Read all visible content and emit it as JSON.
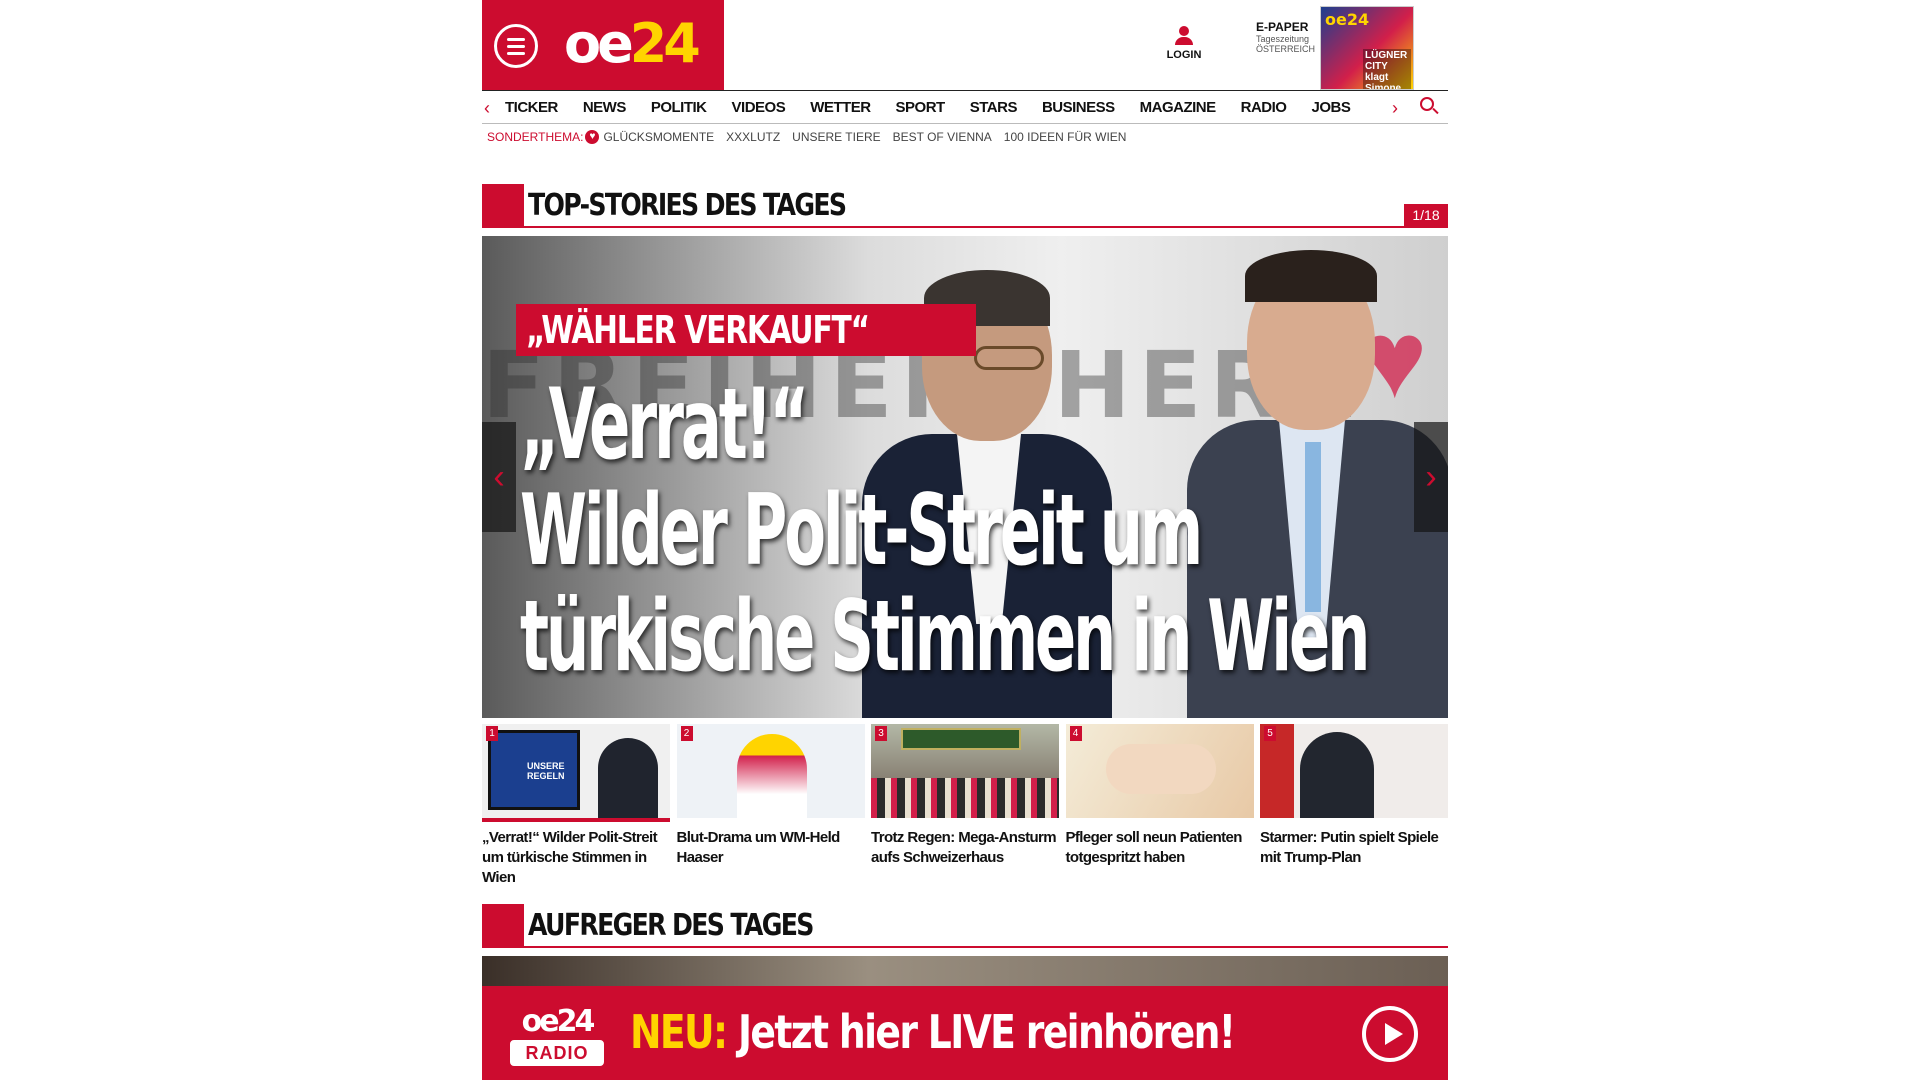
{
  "header": {
    "logo_text": "oe24",
    "login_label": "LOGIN",
    "epaper": {
      "title": "E-PAPER",
      "line2": "Tageszeitung",
      "line3": "ÖSTERREICH"
    },
    "cover_headline": "LÜGNER CITY klagt Simone",
    "brand_color": "#cc0c2f",
    "accent_color": "#ffd400"
  },
  "nav": {
    "items": [
      "TICKER",
      "NEWS",
      "POLITIK",
      "VIDEOS",
      "WETTER",
      "SPORT",
      "STARS",
      "BUSINESS",
      "MAGAZINE",
      "RADIO",
      "JOBS"
    ],
    "prev_arrow": "‹",
    "next_arrow": "›",
    "search_icon": "search-icon"
  },
  "subnav": {
    "label": "SONDERTHEMA:",
    "links": [
      "GLÜCKSMOMENTE",
      "XXXLUTZ",
      "UNSERE TIERE",
      "BEST OF VIENNA",
      "100 IDEEN FÜR WIEN"
    ]
  },
  "top_stories": {
    "title": "TOP-STORIES DES TAGES",
    "counter": "1/18",
    "hero": {
      "kicker": "„WÄHLER VERKAUFT“",
      "headline_line1": "„Verrat!“",
      "headline_line2": "Wilder Polit-Streit um",
      "headline_line3": "türkische Stimmen in Wien",
      "background_text": "FREIHEIT HERZ"
    },
    "thumbnails": [
      {
        "num": "1",
        "caption": "„Verrat!“ Wilder Polit-Streit um türkische Stimmen in Wien",
        "screen_text": "UNSERE REGELN"
      },
      {
        "num": "2",
        "caption": "Blut-Drama um WM-Held Haaser"
      },
      {
        "num": "3",
        "caption": "Trotz Regen: Mega-Ansturm aufs Schweizerhaus"
      },
      {
        "num": "4",
        "caption": "Pfleger soll neun Patienten totgespritzt haben"
      },
      {
        "num": "5",
        "caption": "Starmer: Putin spielt Spiele mit Trump-Plan"
      }
    ]
  },
  "aufreger": {
    "title": "AUFREGER DES TAGES"
  },
  "radio_banner": {
    "logo_text": "oe24",
    "radio_label": "RADIO",
    "neu": "NEU:",
    "text": "Jetzt hier LIVE reinhören!"
  }
}
